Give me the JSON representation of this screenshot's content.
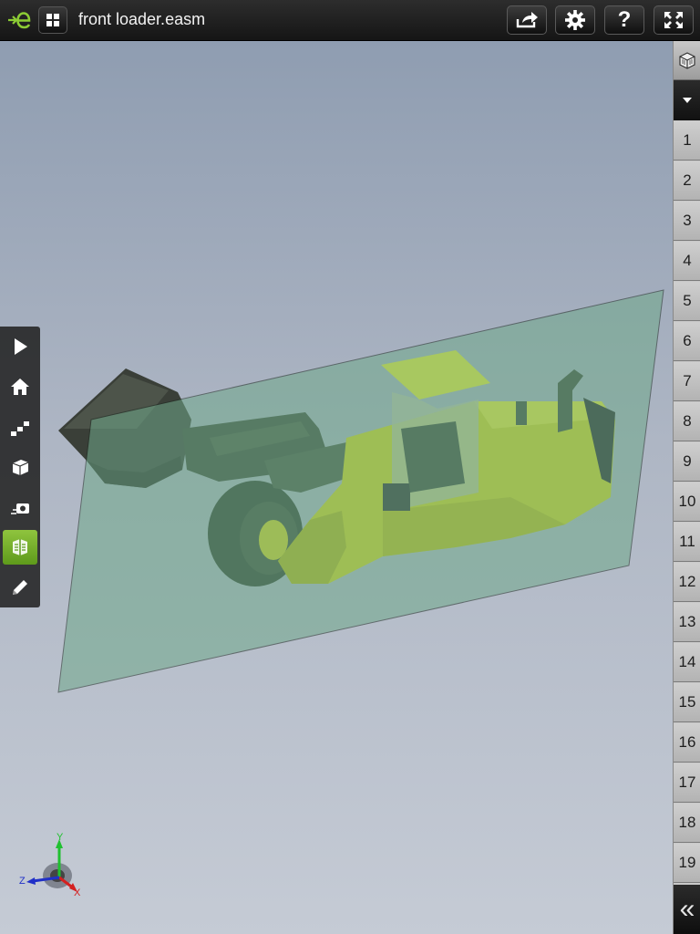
{
  "header": {
    "file_name": "front loader.easm",
    "logo_icon": "edrawings-logo-icon",
    "apps_icon": "grid-icon",
    "buttons": [
      {
        "name": "share-button",
        "icon": "share-icon"
      },
      {
        "name": "settings-button",
        "icon": "gear-icon"
      },
      {
        "name": "help-button",
        "icon": "question-icon"
      },
      {
        "name": "fullscreen-button",
        "icon": "fullscreen-icon"
      }
    ]
  },
  "left_toolbar": {
    "tools": [
      {
        "name": "play",
        "icon": "play-icon",
        "active": false
      },
      {
        "name": "home",
        "icon": "home-icon",
        "active": false
      },
      {
        "name": "explode",
        "icon": "stairs-icon",
        "active": false
      },
      {
        "name": "components",
        "icon": "box-icon",
        "active": false
      },
      {
        "name": "views",
        "icon": "camera-icon",
        "active": false
      },
      {
        "name": "section",
        "icon": "section-icon",
        "active": true
      },
      {
        "name": "markup",
        "icon": "pencil-icon",
        "active": false
      }
    ]
  },
  "steps_rail": {
    "top_icon": "cube-icon",
    "dropdown_icon": "triangle-down-icon",
    "steps": [
      "1",
      "2",
      "3",
      "4",
      "5",
      "6",
      "7",
      "8",
      "9",
      "10",
      "11",
      "12",
      "13",
      "14",
      "15",
      "16",
      "17",
      "18",
      "19"
    ],
    "collapse_label": "«"
  },
  "triad": {
    "x_label": "X",
    "y_label": "Y",
    "z_label": "Z",
    "x_color": "#d42020",
    "y_color": "#20c030",
    "z_color": "#2030c8"
  },
  "colors": {
    "accent": "#7bb52e",
    "model_body": "#e3e318",
    "section_plane": "#6fa88a"
  }
}
